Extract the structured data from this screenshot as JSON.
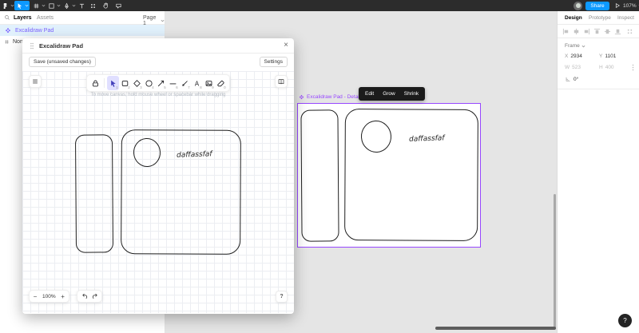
{
  "app": {
    "share_label": "Share",
    "zoom_level": "107%"
  },
  "sidebar": {
    "tabs": [
      "Layers",
      "Assets"
    ],
    "page": "Page 1",
    "layers": [
      {
        "name": "Excalidraw Pad"
      },
      {
        "name": "Non"
      }
    ]
  },
  "modal": {
    "title": "Excalidraw Pad",
    "save_label": "Save (unsaved changes)",
    "settings_label": "Settings",
    "hint": "To move canvas, hold mouse wheel or spacebar while dragging",
    "zoom": "100%",
    "zoom_out": "−",
    "zoom_in": "+",
    "close": "×",
    "drawing_text": "daffassfaf",
    "tool_keys": {
      "selection": "1",
      "rectangle": "2",
      "diamond": "3",
      "ellipse": "4",
      "arrow": "5",
      "line": "6",
      "draw": "7",
      "text": "8",
      "image": "9",
      "eraser": "0"
    }
  },
  "canvas_widget": {
    "label": "Excalidraw Pad - Details",
    "menu": [
      "Edit",
      "Grow",
      "Shrink"
    ],
    "drawing_text": "daffassfaf"
  },
  "inspector": {
    "tabs": [
      "Design",
      "Prototype",
      "Inspect"
    ],
    "section_label": "Frame",
    "x_label": "X",
    "x_value": "2934",
    "y_label": "Y",
    "y_value": "1101",
    "w_label": "W",
    "w_value": "523",
    "h_label": "H",
    "h_value": "400",
    "rotation_value": "0°"
  },
  "help_label": "?",
  "colors": {
    "accent": "#0d99ff",
    "widget_purple": "#9747ff",
    "toolbar_dark": "#2c2c2c"
  }
}
